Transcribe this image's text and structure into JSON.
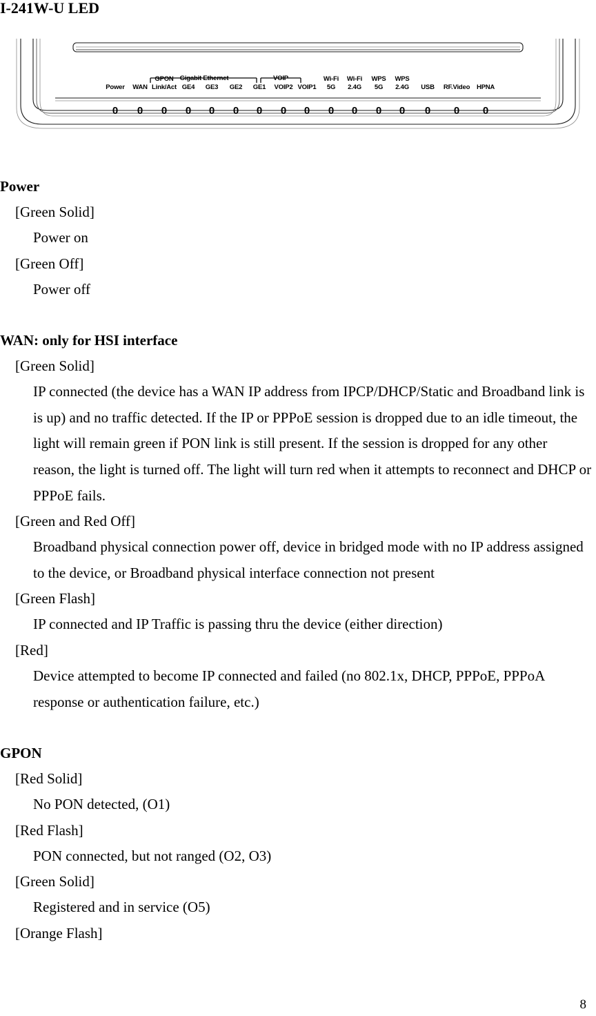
{
  "document": {
    "title": "I-241W-U LED",
    "page_number": "8"
  },
  "device_panel": {
    "indicator_glyph": "0",
    "group_labels": {
      "gigabit_ethernet": "Gigabit Ethernet",
      "voip": "VOIP"
    },
    "leds": [
      {
        "label_line1": "",
        "label_line2": "Power"
      },
      {
        "label_line1": "",
        "label_line2": "WAN"
      },
      {
        "label_line1": "GPON",
        "label_line2": "Link/Act"
      },
      {
        "label_line1": "",
        "label_line2": "GE4"
      },
      {
        "label_line1": "",
        "label_line2": "GE3"
      },
      {
        "label_line1": "",
        "label_line2": "GE2"
      },
      {
        "label_line1": "",
        "label_line2": "GE1"
      },
      {
        "label_line1": "",
        "label_line2": "VOIP2"
      },
      {
        "label_line1": "",
        "label_line2": "VOIP1"
      },
      {
        "label_line1": "Wi-Fi",
        "label_line2": "5G"
      },
      {
        "label_line1": "Wi-Fi",
        "label_line2": "2.4G"
      },
      {
        "label_line1": "WPS",
        "label_line2": "5G"
      },
      {
        "label_line1": "WPS",
        "label_line2": "2.4G"
      },
      {
        "label_line1": "",
        "label_line2": "USB"
      },
      {
        "label_line1": "",
        "label_line2": "RF.Video"
      },
      {
        "label_line1": "",
        "label_line2": "HPNA"
      }
    ]
  },
  "sections": [
    {
      "heading": "Power",
      "entries": [
        {
          "state": "[Green Solid]",
          "description": "Power on"
        },
        {
          "state": "[Green Off]",
          "description": "Power off"
        }
      ]
    },
    {
      "heading": "WAN: only for HSI interface",
      "entries": [
        {
          "state": "[Green Solid]",
          "description": "IP connected (the device has a WAN IP address from IPCP/DHCP/Static and Broadband link is is up) and no traffic detected. If the IP or PPPoE session is dropped due to an idle timeout, the light will remain green if PON link is still present. If the session is dropped for any other reason, the light is turned off. The light will turn red when it attempts to reconnect and DHCP or PPPoE fails."
        },
        {
          "state": "[Green and Red Off]",
          "description": "Broadband physical connection power off, device in bridged mode with no IP address assigned to the device, or Broadband physical interface connection not present"
        },
        {
          "state": "[Green Flash]",
          "description": "IP connected and IP Traffic is passing thru the device (either direction)"
        },
        {
          "state": "[Red]",
          "description": "Device attempted to become IP connected and failed (no 802.1x, DHCP, PPPoE, PPPoA response or authentication failure, etc.)"
        }
      ]
    },
    {
      "heading": "GPON",
      "entries": [
        {
          "state": "[Red Solid]",
          "description": "No PON detected, (O1)"
        },
        {
          "state": "[Red Flash]",
          "description": "PON connected, but not ranged (O2, O3)"
        },
        {
          "state": "[Green Solid]",
          "description": "Registered and in service (O5)"
        },
        {
          "state": "[Orange Flash]",
          "description": ""
        }
      ]
    }
  ]
}
